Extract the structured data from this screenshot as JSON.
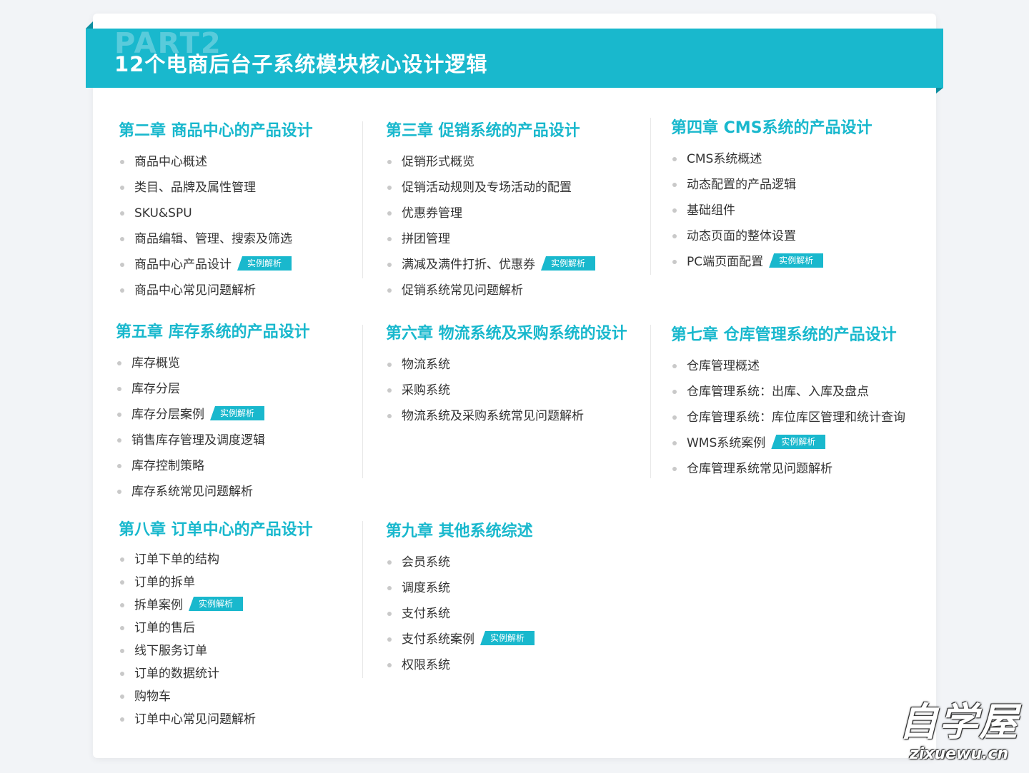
{
  "banner": {
    "part_label": "PART2",
    "title": "12个电商后台子系统模块核心设计逻辑"
  },
  "badge_label": "实例解析",
  "chapters": [
    {
      "title": "第二章 商品中心的产品设计",
      "items": [
        {
          "text": "商品中心概述",
          "badge": ""
        },
        {
          "text": "类目、品牌及属性管理",
          "badge": ""
        },
        {
          "text": "SKU&SPU",
          "badge": ""
        },
        {
          "text": "商品编辑、管理、搜索及筛选",
          "badge": ""
        },
        {
          "text": "商品中心产品设计",
          "badge": "实例解析"
        },
        {
          "text": "商品中心常见问题解析",
          "badge": ""
        }
      ]
    },
    {
      "title": "第三章 促销系统的产品设计",
      "items": [
        {
          "text": "促销形式概览",
          "badge": ""
        },
        {
          "text": "促销活动规则及专场活动的配置",
          "badge": ""
        },
        {
          "text": "优惠券管理",
          "badge": ""
        },
        {
          "text": "拼团管理",
          "badge": ""
        },
        {
          "text": "满减及满件打折、优惠券",
          "badge": "实例解析"
        },
        {
          "text": "促销系统常见问题解析",
          "badge": ""
        }
      ]
    },
    {
      "title": "第四章 CMS系统的产品设计",
      "items": [
        {
          "text": "CMS系统概述",
          "badge": ""
        },
        {
          "text": "动态配置的产品逻辑",
          "badge": ""
        },
        {
          "text": "基础组件",
          "badge": ""
        },
        {
          "text": "动态页面的整体设置",
          "badge": ""
        },
        {
          "text": "PC端页面配置",
          "badge": "实例解析"
        }
      ]
    },
    {
      "title": "第五章 库存系统的产品设计",
      "items": [
        {
          "text": "库存概览",
          "badge": ""
        },
        {
          "text": "库存分层",
          "badge": ""
        },
        {
          "text": "库存分层案例",
          "badge": "实例解析"
        },
        {
          "text": "销售库存管理及调度逻辑",
          "badge": ""
        },
        {
          "text": "库存控制策略",
          "badge": ""
        },
        {
          "text": "库存系统常见问题解析",
          "badge": ""
        }
      ]
    },
    {
      "title": "第六章 物流系统及采购系统的设计",
      "items": [
        {
          "text": "物流系统",
          "badge": ""
        },
        {
          "text": "采购系统",
          "badge": ""
        },
        {
          "text": "物流系统及采购系统常见问题解析",
          "badge": ""
        }
      ]
    },
    {
      "title": "第七章 仓库管理系统的产品设计",
      "items": [
        {
          "text": "仓库管理概述",
          "badge": ""
        },
        {
          "text": "仓库管理系统：出库、入库及盘点",
          "badge": ""
        },
        {
          "text": "仓库管理系统：库位库区管理和统计查询",
          "badge": ""
        },
        {
          "text": "WMS系统案例",
          "badge": "实例解析"
        },
        {
          "text": "仓库管理系统常见问题解析",
          "badge": ""
        }
      ]
    },
    {
      "title": "第八章 订单中心的产品设计",
      "items": [
        {
          "text": "订单下单的结构",
          "badge": ""
        },
        {
          "text": "订单的拆单",
          "badge": ""
        },
        {
          "text": "拆单案例",
          "badge": "实例解析"
        },
        {
          "text": "订单的售后",
          "badge": ""
        },
        {
          "text": "线下服务订单",
          "badge": ""
        },
        {
          "text": "订单的数据统计",
          "badge": ""
        },
        {
          "text": "购物车",
          "badge": ""
        },
        {
          "text": "订单中心常见问题解析",
          "badge": ""
        }
      ]
    },
    {
      "title": "第九章 其他系统综述",
      "items": [
        {
          "text": "会员系统",
          "badge": ""
        },
        {
          "text": "调度系统",
          "badge": ""
        },
        {
          "text": "支付系统",
          "badge": ""
        },
        {
          "text": "支付系统案例",
          "badge": "实例解析"
        },
        {
          "text": "权限系统",
          "badge": ""
        }
      ]
    }
  ],
  "watermark": {
    "cn": "自学屋",
    "en": "zixuewu.cn"
  },
  "colors": {
    "accent": "#19b8cd",
    "text": "#333333",
    "bullet": "#c9c9c9"
  }
}
